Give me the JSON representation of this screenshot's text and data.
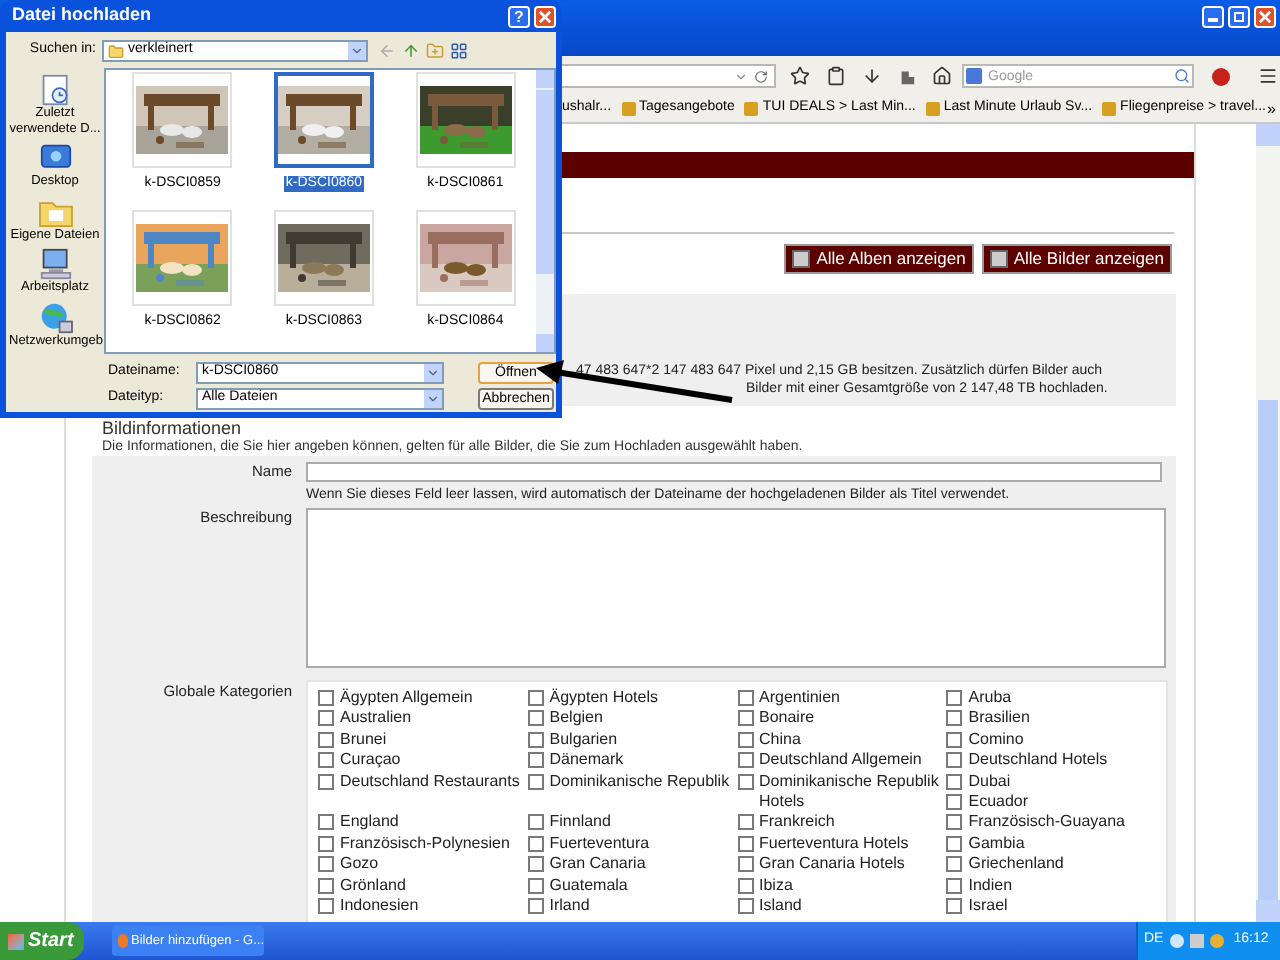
{
  "browser": {
    "search_placeholder": "Google",
    "bookmarks": [
      "ushalr...",
      "Tagesangebote",
      "TUI DEALS > Last Min...",
      "Last Minute Urlaub Sv...",
      "Fliegenpreise > travel..."
    ],
    "bookmarks_more": "»"
  },
  "page": {
    "buttons": [
      "Alle Alben anzeigen",
      "Alle Bilder anzeigen"
    ],
    "quota_lines": [
      "47 483 647*2 147 483 647 Pixel und 2,15 GB besitzen. Zusätzlich dürfen Bilder auch",
      "Bilder mit einer Gesamtgröße von 2 147,48 TB hochladen."
    ],
    "section_title": "Bildinformationen",
    "section_note": "Die Informationen, die Sie hier angeben können, gelten für alle Bilder, die Sie zum Hochladen ausgewählt haben.",
    "name_label": "Name",
    "name_hint": "Wenn Sie dieses Feld leer lassen, wird automatisch der Dateiname der hochgeladenen Bilder als Titel verwendet.",
    "description_label": "Beschreibung",
    "categories_label": "Globale Kategorien",
    "categories": [
      {
        "label": "Ägypten Allgemein",
        "checked": false
      },
      {
        "label": "Ägypten Hotels",
        "checked": false
      },
      {
        "label": "Argentinien",
        "checked": false
      },
      {
        "label": "Aruba",
        "checked": false
      },
      {
        "label": "Australien",
        "checked": false
      },
      {
        "label": "Belgien",
        "checked": false
      },
      {
        "label": "Bonaire",
        "checked": false
      },
      {
        "label": "Brasilien",
        "checked": false
      },
      {
        "label": "Brunei",
        "checked": false
      },
      {
        "label": "Bulgarien",
        "checked": false
      },
      {
        "label": "China",
        "checked": false
      },
      {
        "label": "Comino",
        "checked": false
      },
      {
        "label": "Curaçao",
        "checked": false
      },
      {
        "label": "Dänemark",
        "checked": false
      },
      {
        "label": "Deutschland Allgemein",
        "checked": false
      },
      {
        "label": "Deutschland Hotels",
        "checked": false
      },
      {
        "label": "Deutschland Restaurants",
        "checked": false
      },
      {
        "label": "Dominikanische Republik",
        "checked": false
      },
      {
        "label": "Dominikanische Republik Hotels",
        "checked": false
      },
      {
        "label": "Dubai",
        "checked": false
      },
      {
        "label": "Ecuador",
        "checked": false
      },
      {
        "label": "England",
        "checked": false
      },
      {
        "label": "Finnland",
        "checked": false
      },
      {
        "label": "Frankreich",
        "checked": false
      },
      {
        "label": "Französisch-Guayana",
        "checked": false
      },
      {
        "label": "Französisch-Polynesien",
        "checked": false
      },
      {
        "label": "Fuerteventura",
        "checked": false
      },
      {
        "label": "Fuerteventura Hotels",
        "checked": false
      },
      {
        "label": "Gambia",
        "checked": false
      },
      {
        "label": "Gozo",
        "checked": false
      },
      {
        "label": "Gran Canaria",
        "checked": false
      },
      {
        "label": "Gran Canaria Hotels",
        "checked": false
      },
      {
        "label": "Griechenland",
        "checked": false
      },
      {
        "label": "Grönland",
        "checked": false
      },
      {
        "label": "Guatemala",
        "checked": false
      },
      {
        "label": "Ibiza",
        "checked": false
      },
      {
        "label": "Indien",
        "checked": false
      },
      {
        "label": "Indonesien",
        "checked": false
      },
      {
        "label": "Irland",
        "checked": false
      },
      {
        "label": "Island",
        "checked": false
      },
      {
        "label": "Israel",
        "checked": false
      }
    ]
  },
  "dialog": {
    "title": "Datei hochladen",
    "help": "?",
    "look_in_label": "Suchen in:",
    "look_in_value": "verkleinert",
    "places": [
      {
        "kind": "recent",
        "label": "Zuletzt verwendete D..."
      },
      {
        "kind": "desktop",
        "label": "Desktop"
      },
      {
        "kind": "documents",
        "label": "Eigene Dateien"
      },
      {
        "kind": "computer",
        "label": "Arbeitsplatz"
      },
      {
        "kind": "network",
        "label": "Netzwerkumgeb"
      }
    ],
    "files": [
      {
        "name": "k-DSCI0859",
        "selected": false
      },
      {
        "name": "k-DSCI0860",
        "selected": true
      },
      {
        "name": "k-DSCI0861",
        "selected": false
      },
      {
        "name": "k-DSCI0862",
        "selected": false
      },
      {
        "name": "k-DSCI0863",
        "selected": false
      },
      {
        "name": "k-DSCI0864",
        "selected": false
      }
    ],
    "file_name_label": "Dateiname:",
    "file_name_value": "k-DSCI0860",
    "file_type_label": "Dateityp:",
    "file_type_value": "Alle Dateien",
    "buttons": [
      "Öffnen",
      "Abbrechen"
    ]
  },
  "taskbar": {
    "start": "Start",
    "tasks": [
      "Bilder hinzufügen - G..."
    ],
    "language": "DE",
    "clock": "16:12"
  }
}
